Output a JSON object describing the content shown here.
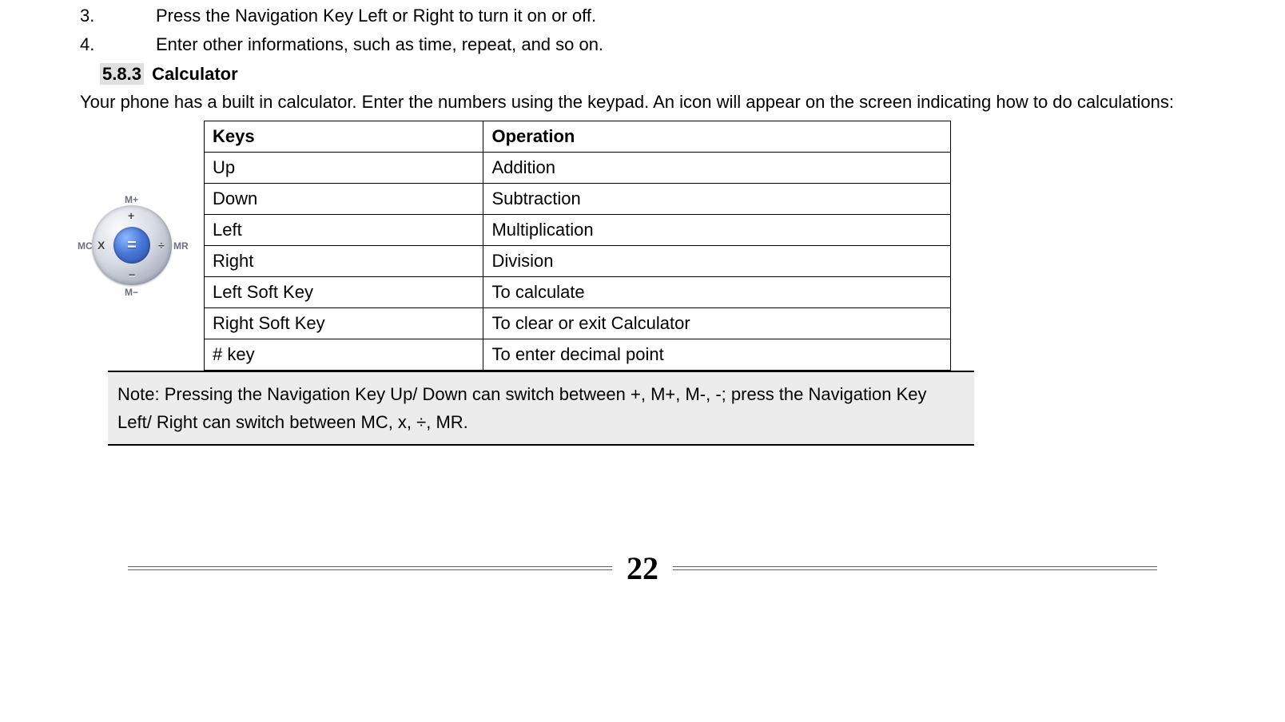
{
  "list": {
    "item3": {
      "num": "3.",
      "text": "Press the Navigation Key Left or Right to turn it on or off."
    },
    "item4": {
      "num": "4.",
      "text": "Enter other informations, such as time, repeat, and so on."
    }
  },
  "section": {
    "num": "5.8.3",
    "title": "Calculator"
  },
  "intro": "Your phone has a built in calculator. Enter the numbers using the keypad. An icon will appear on the screen indicating how to do calculations:",
  "table": {
    "header": {
      "keys": "Keys",
      "operation": "Operation"
    },
    "rows": [
      {
        "keys": "Up",
        "operation": "Addition"
      },
      {
        "keys": "Down",
        "operation": "Subtraction"
      },
      {
        "keys": "Left",
        "operation": "Multiplication"
      },
      {
        "keys": "Right",
        "operation": "Division"
      },
      {
        "keys": "Left Soft Key",
        "operation": "To calculate"
      },
      {
        "keys": "Right Soft Key",
        "operation": "To clear or exit Calculator"
      },
      {
        "keys": "# key",
        "operation": "To enter decimal point"
      }
    ]
  },
  "note": "Note: Pressing the Navigation Key Up/ Down can switch between +, M+, M-, -; press the Navigation Key Left/ Right can switch between MC, x, ÷, MR.",
  "dpad": {
    "center": "=",
    "plus": "+",
    "minus": "−",
    "times": "X",
    "div": "÷",
    "mplus": "M+",
    "mminus": "M−",
    "mc": "MC",
    "mr": "MR"
  },
  "page_number": "22"
}
